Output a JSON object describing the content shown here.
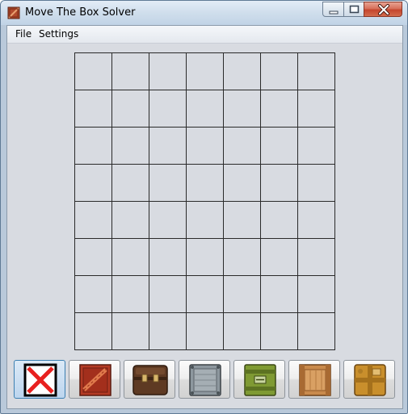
{
  "window": {
    "title": "Move The Box Solver"
  },
  "menu": [
    {
      "label": "File"
    },
    {
      "label": "Settings"
    }
  ],
  "board": {
    "columns": 7,
    "rows": 8
  },
  "palette": {
    "selected_index": 0,
    "items": [
      {
        "icon": "empty-cell-icon"
      },
      {
        "icon": "red-crate-icon"
      },
      {
        "icon": "brown-suitcase-icon"
      },
      {
        "icon": "metal-crate-icon"
      },
      {
        "icon": "green-crate-icon"
      },
      {
        "icon": "wooden-crate-icon"
      },
      {
        "icon": "cardboard-box-icon"
      }
    ]
  }
}
